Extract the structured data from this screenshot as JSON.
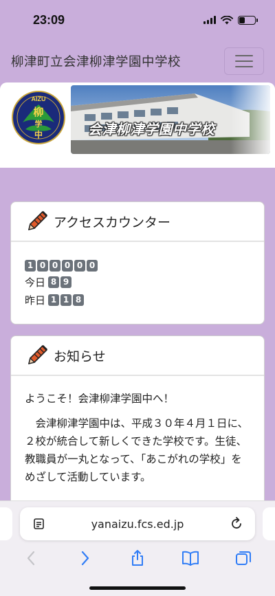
{
  "status_bar": {
    "time": "23:09",
    "battery_level": 0.35
  },
  "header": {
    "title": "柳津町立会津柳津学園中学校"
  },
  "banner": {
    "logo_text_top": "AIZU",
    "logo_text_main": "柳",
    "logo_text_sub": "学",
    "logo_text_bottom": "中",
    "title": "会津柳津学園中学校"
  },
  "counter_card": {
    "title": "アクセスカウンター",
    "total_digits": [
      "1",
      "0",
      "0",
      "0",
      "0",
      "0"
    ],
    "today_label": "今日",
    "today_digits": [
      "8",
      "9"
    ],
    "yesterday_label": "昨日",
    "yesterday_digits": [
      "1",
      "1",
      "8"
    ]
  },
  "news_card": {
    "title": "お知らせ",
    "greeting": "ようこそ！会津柳津学園中へ！",
    "body": "　会津柳津学園中は、平成３０年４月１日に、２校が統合して新しくできた学校です。生徒、教職員が一丸となって、「あこがれの学校」をめざして活動しています。"
  },
  "browser": {
    "url": "yanaizu.fcs.ed.jp"
  },
  "colors": {
    "background": "#c9aedb",
    "accent_pencil": "#e05a2b"
  },
  "icons": [
    "pencil-icon",
    "menu-icon",
    "reader-icon",
    "reload-icon",
    "back-icon",
    "forward-icon",
    "share-icon",
    "bookmarks-icon",
    "tabs-icon"
  ]
}
